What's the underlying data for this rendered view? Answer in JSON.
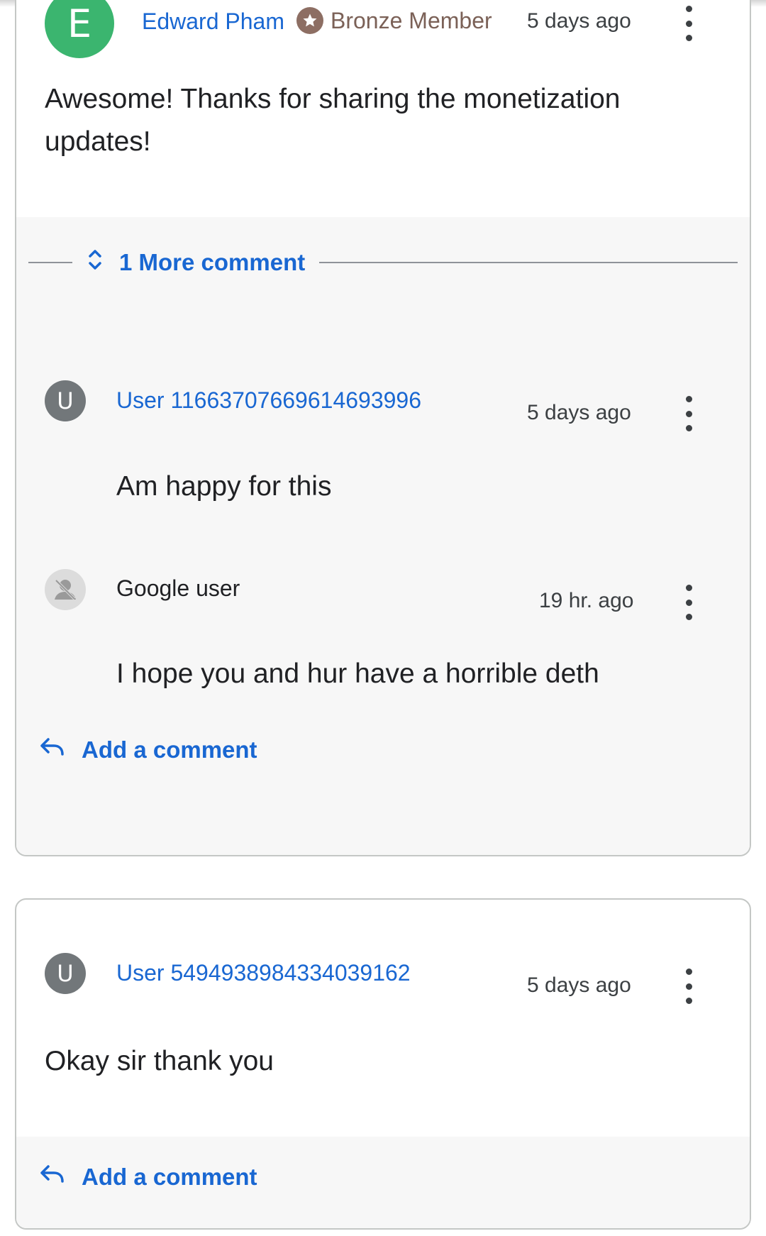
{
  "threads": [
    {
      "author": {
        "initial": "E",
        "name": "Edward Pham",
        "badge": "Bronze Member"
      },
      "time": "5 days ago",
      "body": "Awesome! Thanks for sharing the monetization updates!",
      "more_comments_label": "1 More comment",
      "replies": [
        {
          "initial": "U",
          "name": "User 11663707669614693996",
          "time": "5 days ago",
          "body": "Am happy for this"
        },
        {
          "name": "Google user",
          "time": "19 hr. ago",
          "body": "I hope you and hur have a horrible deth"
        }
      ],
      "add_comment_label": "Add a comment"
    },
    {
      "author": {
        "initial": "U",
        "name": "User 5494938984334039162"
      },
      "time": "5 days ago",
      "body": "Okay sir thank you",
      "add_comment_label": "Add a comment"
    }
  ],
  "colors": {
    "link": "#1967d2",
    "badge": "#7b6157",
    "avatar_green": "#3bb56f",
    "avatar_grey": "#72777a"
  },
  "icons": [
    "star-badge-icon",
    "expand-icon",
    "more-vert-icon",
    "reply-icon",
    "anonymous-user-icon"
  ]
}
